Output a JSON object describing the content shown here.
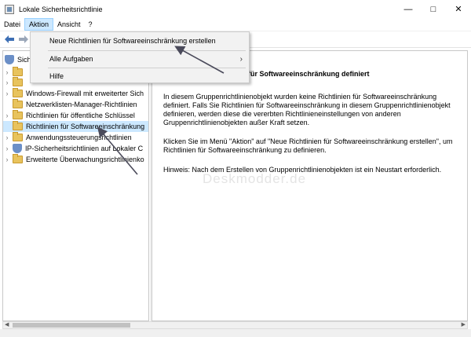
{
  "window": {
    "title": "Lokale Sicherheitsrichtlinie",
    "controls": [
      "minimize-icon",
      "maximize-icon",
      "close-icon"
    ]
  },
  "menubar": {
    "items": [
      "Datei",
      "Aktion",
      "Ansicht",
      "?"
    ],
    "active_index": 1
  },
  "dropdown": {
    "items": [
      {
        "label": "Neue Richtlinien für Softwareeinschränkung erstellen",
        "submenu": false
      },
      {
        "label": "Alle Aufgaben",
        "submenu": true
      },
      {
        "label": "Hilfe",
        "submenu": false
      }
    ]
  },
  "tree": {
    "root_label_partial": "Sich",
    "items": [
      {
        "label": "Windows-Firewall mit erweiterter Sich",
        "icon": "folder-icon",
        "expandable": true
      },
      {
        "label": "Netzwerklisten-Manager-Richtlinien",
        "icon": "folder-icon",
        "expandable": false
      },
      {
        "label": "Richtlinien für öffentliche Schlüssel",
        "icon": "folder-icon",
        "expandable": true
      },
      {
        "label": "Richtlinien für Softwareeinschränkung",
        "icon": "folder-icon",
        "expandable": false,
        "selected": true
      },
      {
        "label": "Anwendungssteuerungsrichtlinien",
        "icon": "folder-icon",
        "expandable": true
      },
      {
        "label": "IP-Sicherheitsrichtlinien auf Lokaler C",
        "icon": "shield-icon",
        "expandable": true
      },
      {
        "label": "Erweiterte Überwachungsrichtlinienko",
        "icon": "folder-icon",
        "expandable": true
      }
    ]
  },
  "content": {
    "title_partial": "für Softwareeinschränkung definiert",
    "para1": "In diesem Gruppenrichtlinienobjekt wurden keine Richtlinien für Softwareeinschränkung definiert. Falls Sie Richtlinien für Softwareeinschränkung in diesem Gruppenrichtlinienobjekt definieren, werden diese die vererbten Richtlinieneinstellungen von anderen Gruppenrichtlinienobjekten außer Kraft setzen.",
    "para2": "Klicken Sie im Menü \"Aktion\" auf \"Neue Richtlinien für Softwareeinschränkung erstellen\", um Richtlinien für Softwareeinschränkung zu definieren.",
    "para3": "Hinweis: Nach dem Erstellen von Gruppenrichtlinienobjekten ist ein Neustart erforderlich."
  },
  "watermark": "Deskmodder.de",
  "colors": {
    "menu_active": "#cce8ff",
    "selection": "#cce8ff",
    "annotation_arrow": "#4a4a5a"
  }
}
